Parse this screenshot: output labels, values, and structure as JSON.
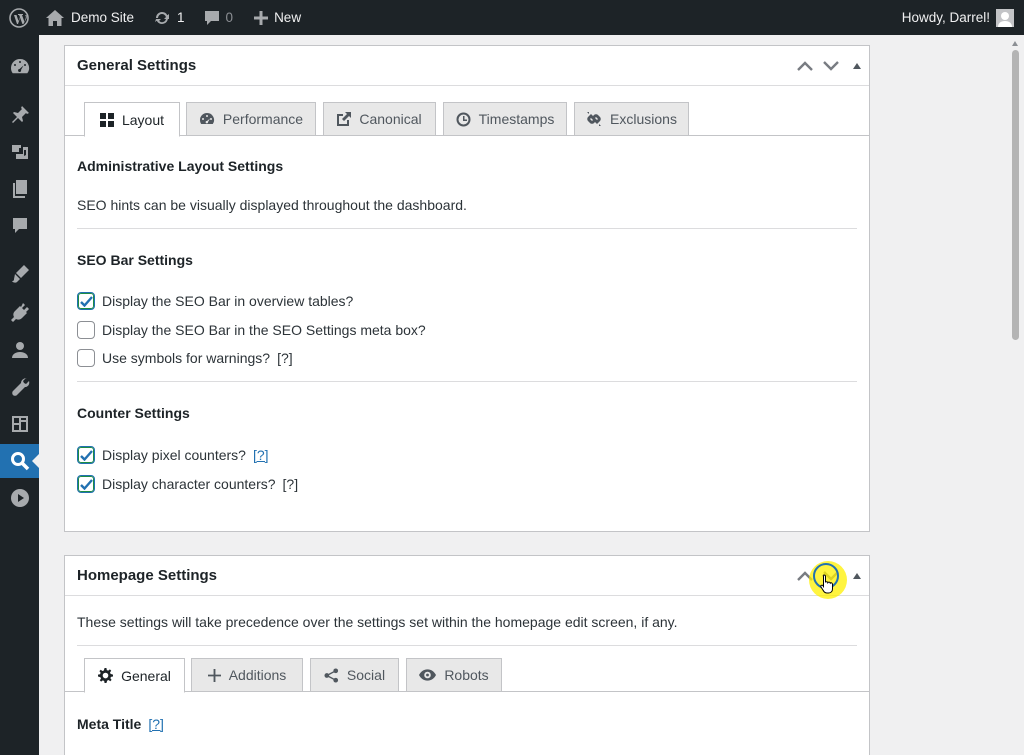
{
  "adminbar": {
    "site_name": "Demo Site",
    "updates_count": "1",
    "comments_count": "0",
    "new_label": "New",
    "greeting": "Howdy, Darrel!"
  },
  "general": {
    "title": "General Settings",
    "tabs": [
      {
        "label": "Layout",
        "icon": "grid-icon"
      },
      {
        "label": "Performance",
        "icon": "dashboard-gauge-icon"
      },
      {
        "label": "Canonical",
        "icon": "external-link-icon"
      },
      {
        "label": "Timestamps",
        "icon": "clock-icon"
      },
      {
        "label": "Exclusions",
        "icon": "broken-link-icon"
      }
    ],
    "admin_layout_heading": "Administrative Layout Settings",
    "admin_layout_desc": "SEO hints can be visually displayed throughout the dashboard.",
    "seo_bar_heading": "SEO Bar Settings",
    "seo_bar_options": [
      {
        "label": "Display the SEO Bar in overview tables?",
        "checked": true
      },
      {
        "label": "Display the SEO Bar in the SEO Settings meta box?",
        "checked": false
      },
      {
        "label": "Use symbols for warnings?",
        "help": "[?]",
        "checked": false
      }
    ],
    "counter_heading": "Counter Settings",
    "counter_options": [
      {
        "label": "Display pixel counters?",
        "help": "[?]",
        "checked": true
      },
      {
        "label": "Display character counters?",
        "help": "[?]",
        "checked": true
      }
    ]
  },
  "homepage": {
    "title": "Homepage Settings",
    "desc": "These settings will take precedence over the settings set within the homepage edit screen, if any.",
    "tabs": [
      {
        "label": "General",
        "icon": "gear-icon"
      },
      {
        "label": "Additions",
        "icon": "plus-icon"
      },
      {
        "label": "Social",
        "icon": "share-icon"
      },
      {
        "label": "Robots",
        "icon": "eye-icon"
      }
    ],
    "meta_title_label": "Meta Title",
    "meta_title_help": "[?]"
  },
  "colors": {
    "adminbar_bg": "#1d2327",
    "accent": "#2271b1",
    "cursor_highlight": "#fff000"
  }
}
